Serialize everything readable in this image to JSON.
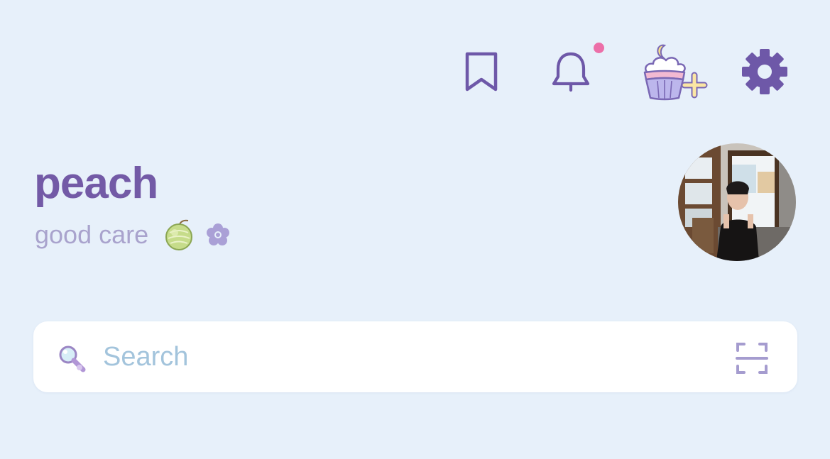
{
  "header": {
    "icons": [
      "bookmark-icon",
      "bell-icon",
      "cupcake-add-icon",
      "gear-icon"
    ],
    "notification_dot": true
  },
  "profile": {
    "username": "peach",
    "bio": "good care",
    "bio_emojis": [
      "melon-emoji",
      "flower-icon"
    ],
    "avatar": "profile-photo"
  },
  "search": {
    "placeholder": "Search",
    "value": "",
    "icons": [
      "magnifier-icon",
      "scan-icon"
    ]
  },
  "colors": {
    "background": "#e7f0fa",
    "accent": "#735aa6",
    "muted": "#a9a3cd",
    "notification": "#ec6fa8",
    "search_placeholder": "#a3c4dc"
  }
}
